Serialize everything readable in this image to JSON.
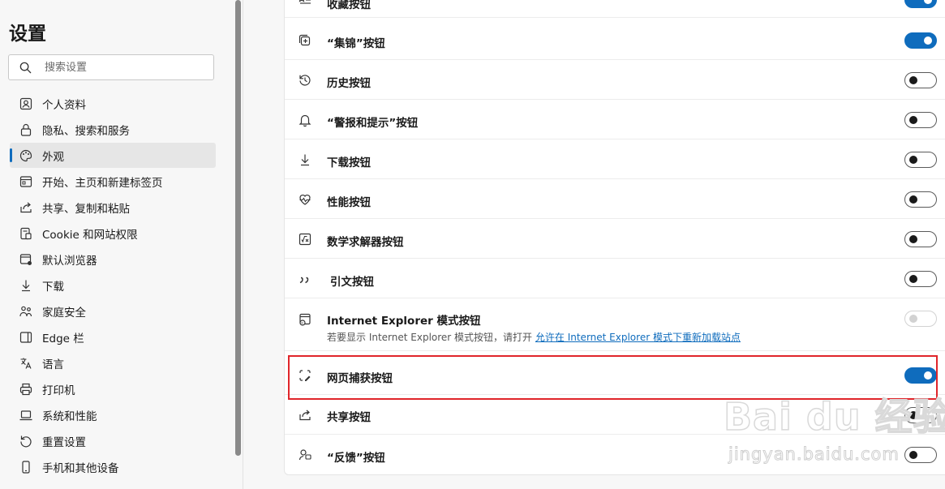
{
  "sidebar": {
    "title": "设置",
    "search_placeholder": "搜索设置",
    "items": [
      {
        "label": "个人资料",
        "icon": "profile-icon"
      },
      {
        "label": "隐私、搜索和服务",
        "icon": "lock-icon"
      },
      {
        "label": "外观",
        "icon": "palette-icon",
        "active": true
      },
      {
        "label": "开始、主页和新建标签页",
        "icon": "home-tab-icon"
      },
      {
        "label": "共享、复制和粘贴",
        "icon": "share-icon"
      },
      {
        "label": "Cookie 和网站权限",
        "icon": "cookie-icon"
      },
      {
        "label": "默认浏览器",
        "icon": "browser-icon"
      },
      {
        "label": "下载",
        "icon": "download-icon"
      },
      {
        "label": "家庭安全",
        "icon": "family-icon"
      },
      {
        "label": "Edge 栏",
        "icon": "edge-bar-icon"
      },
      {
        "label": "语言",
        "icon": "language-icon"
      },
      {
        "label": "打印机",
        "icon": "printer-icon"
      },
      {
        "label": "系统和性能",
        "icon": "laptop-icon"
      },
      {
        "label": "重置设置",
        "icon": "reset-icon"
      },
      {
        "label": "手机和其他设备",
        "icon": "phone-icon"
      }
    ]
  },
  "rows": [
    {
      "label": "收藏按钮",
      "icon": "favorites-icon",
      "state": "on"
    },
    {
      "label": "“集锦”按钮",
      "icon": "collections-icon",
      "state": "on"
    },
    {
      "label": "历史按钮",
      "icon": "history-icon",
      "state": "off"
    },
    {
      "label": "“警报和提示”按钮",
      "icon": "bell-icon",
      "state": "off"
    },
    {
      "label": "下载按钮",
      "icon": "download-icon",
      "state": "off"
    },
    {
      "label": "性能按钮",
      "icon": "heartbeat-icon",
      "state": "off"
    },
    {
      "label": "数学求解器按钮",
      "icon": "math-solver-icon",
      "state": "off"
    },
    {
      "label": "引文按钮",
      "icon": "quote-icon",
      "state": "off"
    },
    {
      "label": "Internet Explorer 模式按钮",
      "icon": "ie-mode-icon",
      "state": "disabled",
      "sub_text": "若要显示 Internet Explorer 模式按钮，请打开",
      "sub_link": "允许在 Internet Explorer 模式下重新加载站点"
    },
    {
      "label": "网页捕获按钮",
      "icon": "web-capture-icon",
      "state": "on"
    },
    {
      "label": "共享按钮",
      "icon": "share-icon",
      "state": "off"
    },
    {
      "label": "“反馈”按钮",
      "icon": "feedback-icon",
      "state": "off"
    }
  ],
  "watermark": {
    "brand": "Bai du 经验",
    "url": "jingyan.baidu.com"
  },
  "colors": {
    "accent": "#0f6cbd",
    "highlight": "#e0252a"
  }
}
